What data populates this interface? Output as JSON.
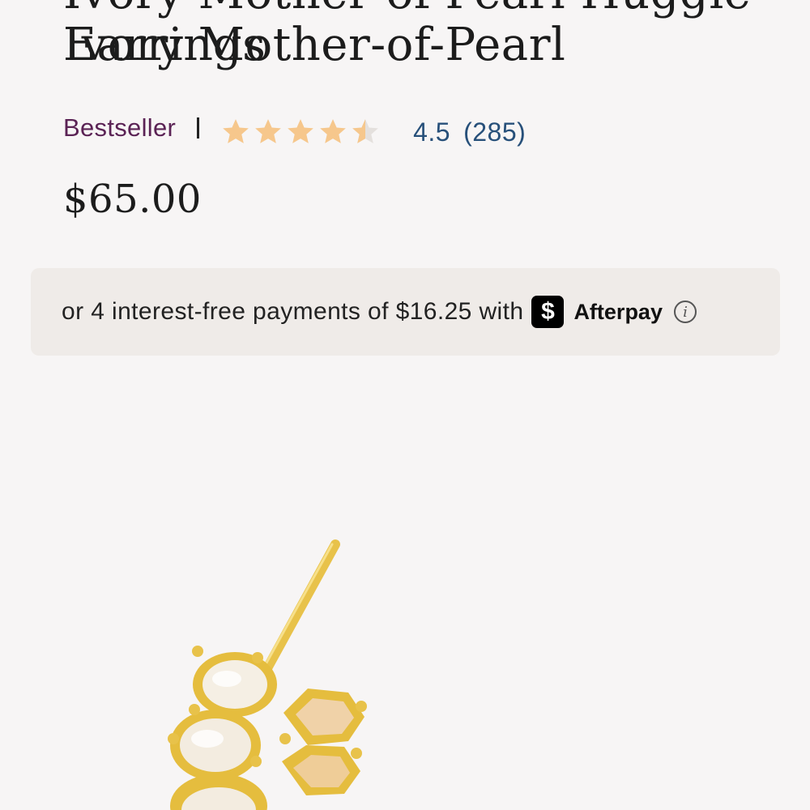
{
  "product": {
    "title_line1": "Ivory Mother-of-Pearl Huggie Earrings",
    "title_line2": "Ivory Mother-of-Pearl",
    "badge": "Bestseller",
    "separator": "|",
    "rating": "4.5",
    "rating_value": 4.5,
    "rating_max": 5,
    "review_count": "(285)",
    "price": "$65.00"
  },
  "afterpay": {
    "text": "or 4 interest-free payments of $16.25 with",
    "badge_glyph": "$",
    "brand": "Afterpay",
    "info_glyph": "i"
  },
  "colors": {
    "star": "#f6c78c",
    "star_empty": "#dddddd",
    "badge": "#5b2355",
    "rating": "#27507a",
    "gold": "#e7c04a",
    "pearl": "#f3ece0"
  },
  "icons": {
    "star": "star-icon",
    "info": "info-icon",
    "afterpay": "afterpay-logo-icon"
  }
}
